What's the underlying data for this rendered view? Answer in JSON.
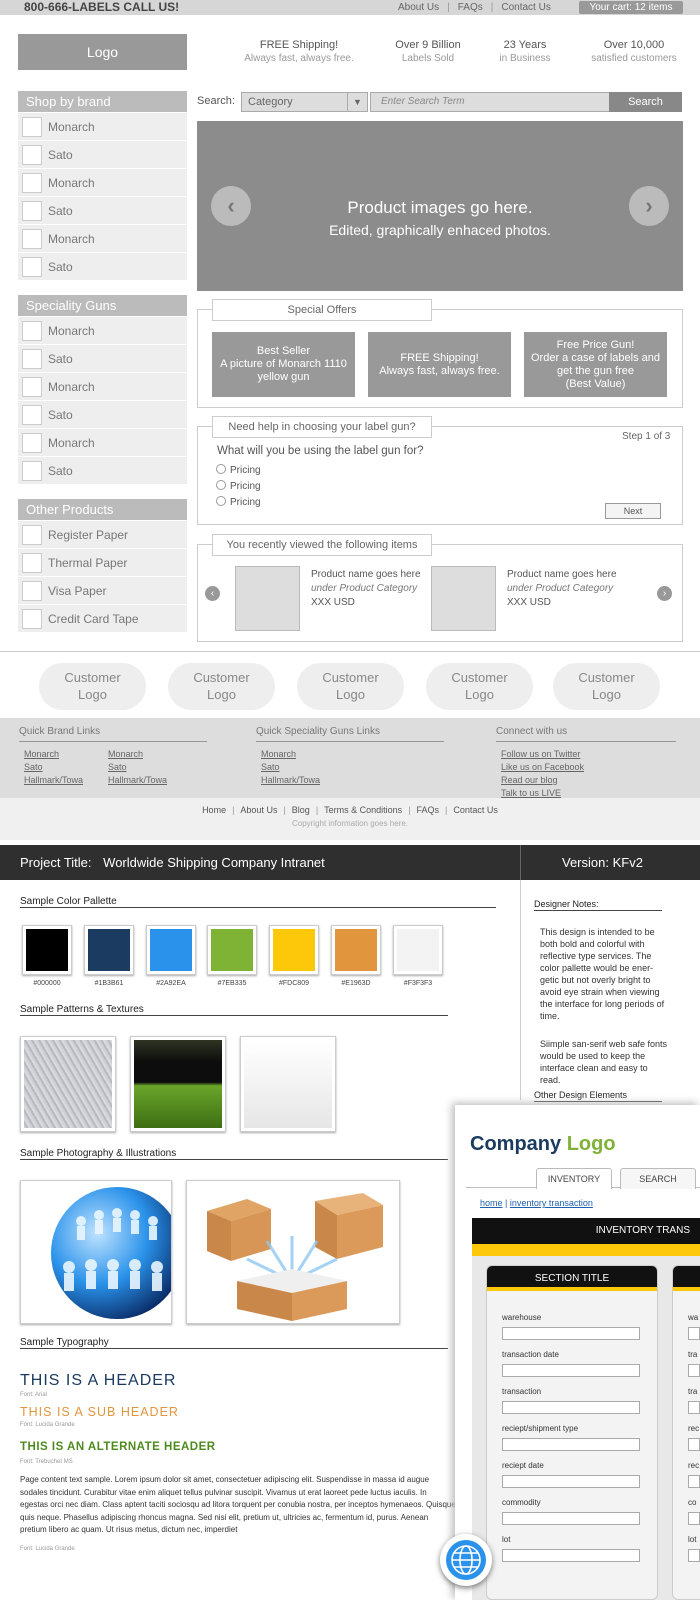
{
  "wireframe": {
    "phone": "800-666-LABELS  CALL US!",
    "top_links": [
      "About Us",
      "FAQs",
      "Contact Us"
    ],
    "cart": "Your cart: 12 items",
    "logo": "Logo",
    "stats": [
      {
        "title": "FREE Shipping!",
        "sub": "Always fast, always free."
      },
      {
        "title": "Over 9 Billion",
        "sub": "Labels Sold"
      },
      {
        "title": "23 Years",
        "sub": "in Business"
      },
      {
        "title": "Over 10,000",
        "sub": "satisfied customers"
      }
    ],
    "search": {
      "label": "Search:",
      "category": "Category",
      "placeholder": "Enter Search Term",
      "button": "Search"
    },
    "sidebar": [
      {
        "title": "Shop by brand",
        "items": [
          "Monarch",
          "Sato",
          "Monarch",
          "Sato",
          "Monarch",
          "Sato"
        ]
      },
      {
        "title": "Speciality Guns",
        "items": [
          "Monarch",
          "Sato",
          "Monarch",
          "Sato",
          "Monarch",
          "Sato"
        ]
      },
      {
        "title": "Other Products",
        "items": [
          "Register Paper",
          "Thermal Paper",
          "Visa Paper",
          "Credit Card Tape"
        ]
      }
    ],
    "hero": {
      "line1": "Product images go here.",
      "line2": "Edited, graphically enhaced photos."
    },
    "special_offers": {
      "title": "Special Offers",
      "offers": [
        "Best Seller\nA picture of Monarch 1110 yellow gun",
        "FREE Shipping!\nAlways fast, always free.",
        "Free Price Gun!\nOrder a case of labels and get the gun free\n(Best Value)"
      ]
    },
    "help": {
      "title": "Need help in choosing your label gun?",
      "step": "Step 1 of 3",
      "question": "What will you be using the label gun for?",
      "options": [
        "Pricing",
        "Pricing",
        "Pricing"
      ],
      "next": "Next"
    },
    "recent": {
      "title": "You recently viewed the following items",
      "items": [
        {
          "name": "Product name goes here",
          "category": "under Product Category",
          "price": "XXX USD"
        },
        {
          "name": "Product name goes here",
          "category": "under Product Category",
          "price": "XXX USD"
        }
      ]
    },
    "customers": [
      "Customer\nLogo",
      "Customer\nLogo",
      "Customer\nLogo",
      "Customer\nLogo",
      "Customer\nLogo"
    ],
    "footer": {
      "brand_title": "Quick Brand Links",
      "brand_col1": [
        "Monarch",
        "Sato",
        "Hallmark/Towa"
      ],
      "brand_col2": [
        "Monarch",
        "Sato",
        "Hallmark/Towa"
      ],
      "guns_title": "Quick Speciality Guns Links",
      "guns": [
        "Monarch",
        "Sato",
        "Hallmark/Towa"
      ],
      "connect_title": "Connect with us",
      "connect": [
        "Follow us on Twitter",
        "Like us on Facebook",
        "Read our blog",
        "Talk to us LIVE"
      ],
      "bottom_links": [
        "Home",
        "About Us",
        "Blog",
        "Terms & Conditions",
        "FAQs",
        "Contact Us"
      ],
      "copyright": "Copyright information goes here."
    }
  },
  "styleguide": {
    "project_label": "Project Title:",
    "project_title": "Worldwide Shipping Company Intranet",
    "version": "Version: KFv2",
    "palette_title": "Sample Color Pallette",
    "palette": [
      "#000000",
      "#1B3B61",
      "#2A92EA",
      "#7EB335",
      "#FDC809",
      "#E1963D",
      "#F3F3F3"
    ],
    "patterns_title": "Sample Patterns & Textures",
    "photos_title": "Sample Photography & Illustrations",
    "typography_title": "Sample Typography",
    "header": "THIS IS A HEADER",
    "header_font": "Font: Arial",
    "subheader": "THIS IS A SUB HEADER",
    "subheader_font": "Font: Lucida Grande",
    "alt_header": "THIS IS AN ALTERNATE HEADER",
    "alt_header_font": "Font: Trebuchet MS",
    "body_text": "Page content text sample. Lorem ipsum dolor sit amet, consectetuer adipiscing elit. Suspendisse in massa id augue sodales tincidunt. Curabitur vitae enim aliquet tellus pulvinar suscipit. Vivamus ut erat laoreet pede luctus iaculis. In egestas orci nec diam. Class aptent taciti sociosqu ad litora torquent per conubia nostra, per inceptos hymenaeos. Quisque quis neque. Phasellus adipiscing rhoncus magna. Sed nisi elit, pretium ut, ultricies ac, fermentum id, purus. Aenean pretium libero ac quam. Ut risus metus, dictum nec, imperdiet",
    "body_font": "Font: Lucida Grande",
    "designer_notes_title": "Designer Notes:",
    "designer_notes_1": "This design is intended to be both bold and colorful with reflective type services. The color pallette would be ener- getic but not overly bright to avoid eye strain when viewing the interface for long periods of time.",
    "designer_notes_2": "Siimple san-serif web safe fonts would be used to keep the interface clean and easy to read.",
    "other_elements_title": "Other Design Elements"
  },
  "app": {
    "logo_company": "Company",
    "logo_word": "Logo",
    "tabs": [
      "INVENTORY",
      "SEARCH"
    ],
    "breadcrumb": [
      "home",
      "inventory transaction"
    ],
    "bar_title": "INVENTORY TRANS",
    "section_title": "SECTION TITLE",
    "fields": [
      "warehouse",
      "transaction date",
      "transaction",
      "reciept/shipment type",
      "reciept date",
      "commodity",
      "lot"
    ],
    "second_fields": [
      "wa",
      "tra",
      "tra",
      "rec",
      "rec",
      "co",
      "lot"
    ]
  }
}
